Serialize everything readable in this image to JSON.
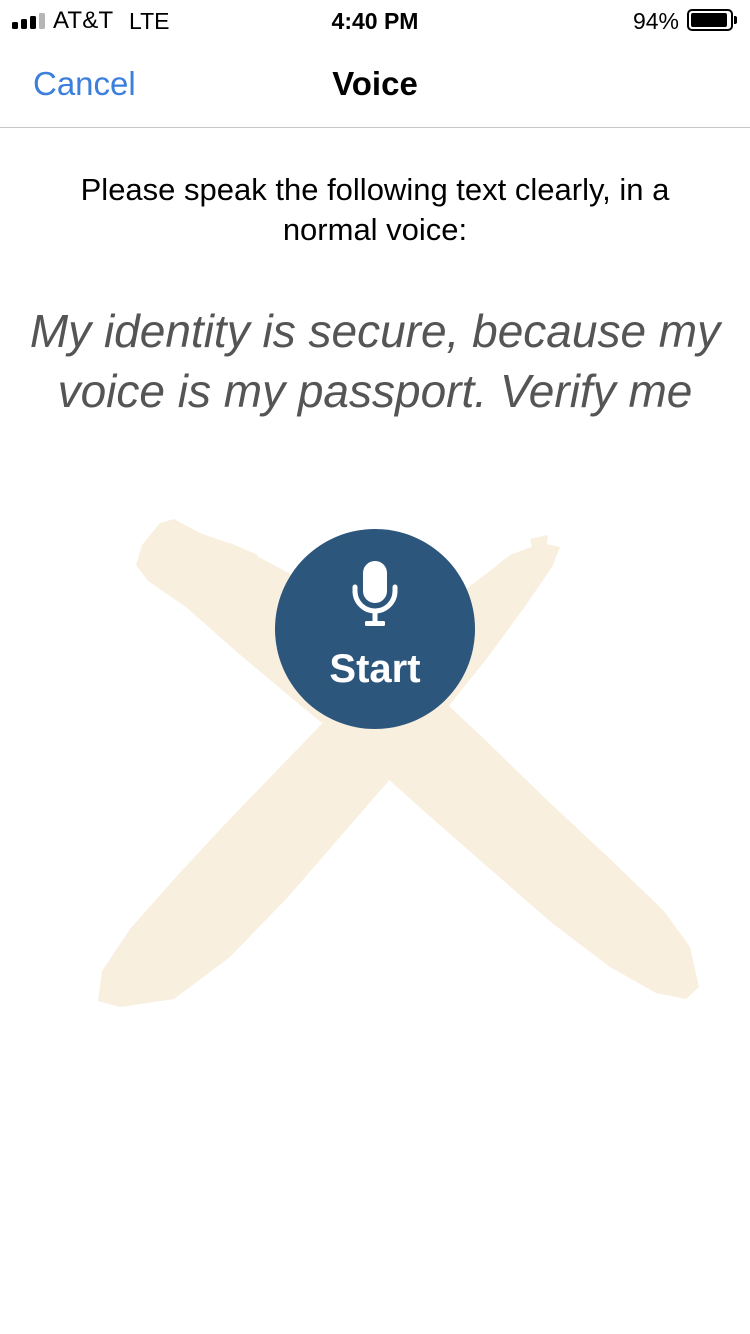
{
  "status_bar": {
    "carrier": "AT&T",
    "network": "LTE",
    "time": "4:40 PM",
    "battery_percent": "94%",
    "battery_level": 0.94,
    "signal_bars_active": 3,
    "signal_bars_total": 4
  },
  "nav": {
    "cancel_label": "Cancel",
    "title": "Voice"
  },
  "content": {
    "instruction": "Please speak the following text clearly, in a normal voice:",
    "phrase": "My identity is secure, because my voice is my passport. Verify me"
  },
  "start_button": {
    "label": "Start",
    "icon": "microphone-icon"
  },
  "colors": {
    "link": "#3c7fdc",
    "button": "#2d567c",
    "phrase_text": "#555555",
    "x_mark": "#f8efde"
  }
}
